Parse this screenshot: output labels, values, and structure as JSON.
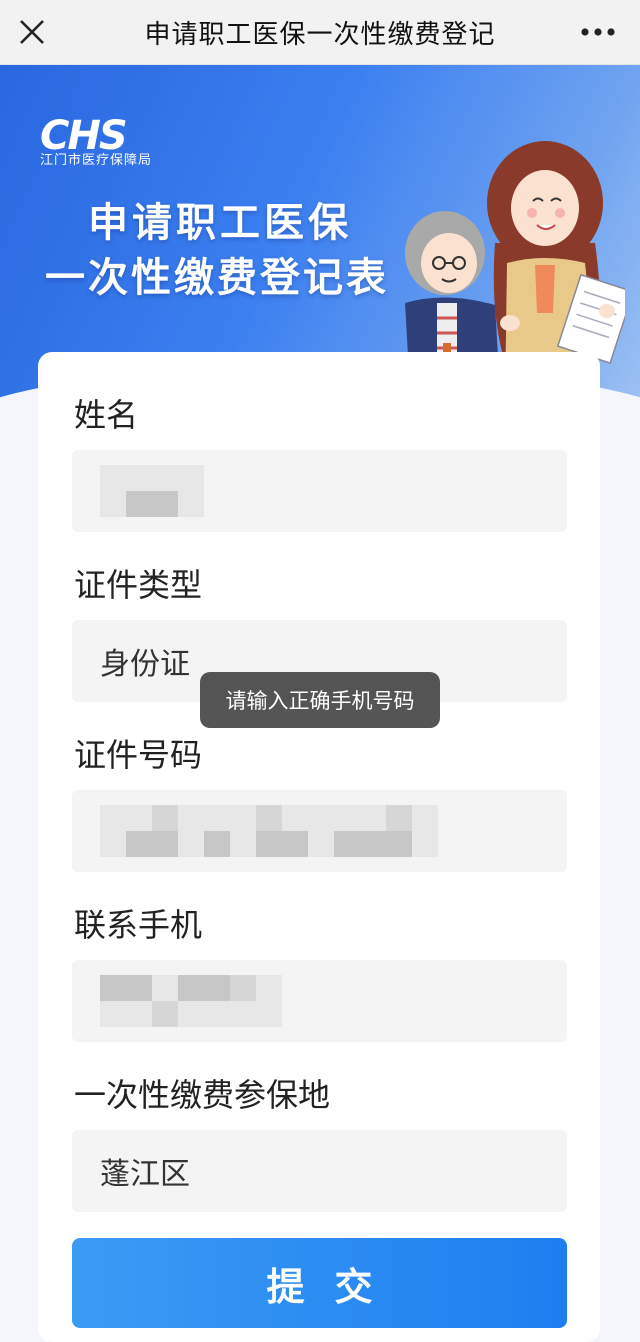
{
  "header": {
    "title": "申请职工医保一次性缴费登记",
    "close_icon": "close-icon",
    "more_icon": "more-icon"
  },
  "banner": {
    "logo_text": "CHS",
    "logo_subtext": "江门市医疗保障局",
    "title_line1": "申请职工医保",
    "title_line2": "一次性缴费登记表"
  },
  "form": {
    "name_label": "姓名",
    "id_type_label": "证件类型",
    "id_type_value": "身份证",
    "id_number_label": "证件号码",
    "phone_label": "联系手机",
    "location_label": "一次性缴费参保地",
    "location_value": "蓬江区",
    "submit_label": "提交"
  },
  "toast": {
    "message": "请输入正确手机号码"
  },
  "colors": {
    "primary": "#1e7ef0",
    "banner_start": "#2a67df",
    "banner_end": "#9cc0f3"
  }
}
